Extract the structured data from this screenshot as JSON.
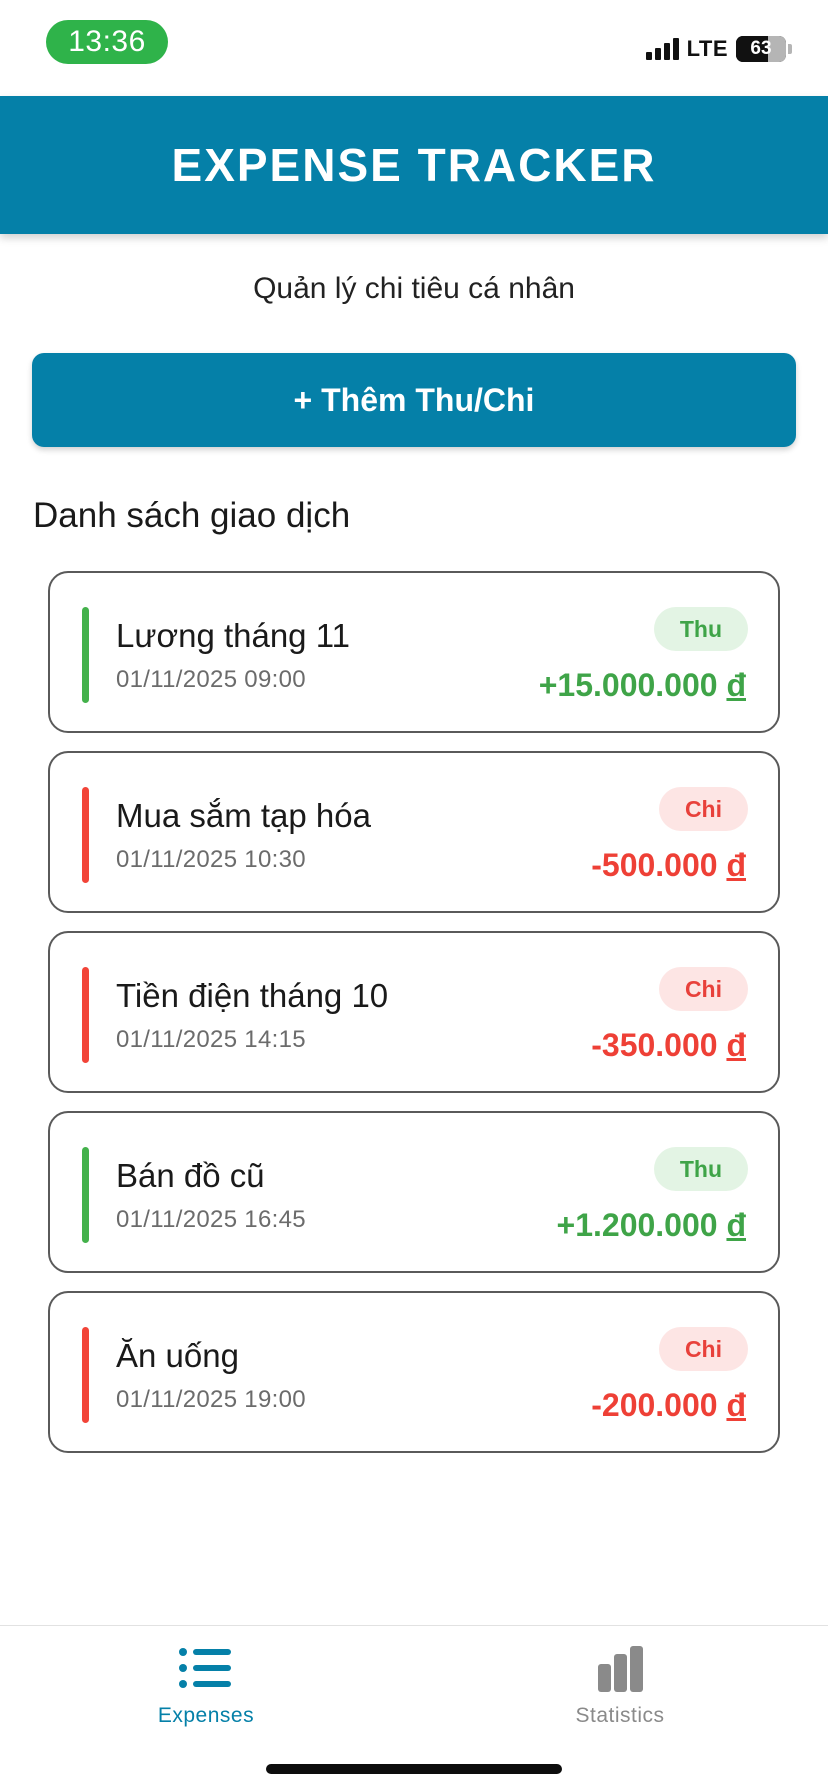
{
  "status_bar": {
    "time": "13:36",
    "network": "LTE",
    "battery": "63",
    "time_pill_color": "#2fb34a"
  },
  "header": {
    "title": "EXPENSE TRACKER",
    "color": "#0580a8"
  },
  "subtitle": "Quản lý chi tiêu cá nhân",
  "add_button": {
    "label": "+ Thêm Thu/Chi"
  },
  "section_title": "Danh sách giao dịch",
  "transactions": [
    {
      "name": "Lương tháng 11",
      "datetime": "01/11/2025 09:00",
      "type_label": "Thu",
      "kind": "income",
      "amount": "+15.000.000",
      "currency": "đ"
    },
    {
      "name": "Mua sắm tạp hóa",
      "datetime": "01/11/2025 10:30",
      "type_label": "Chi",
      "kind": "expense",
      "amount": "-500.000",
      "currency": "đ"
    },
    {
      "name": "Tiền điện tháng 10",
      "datetime": "01/11/2025 14:15",
      "type_label": "Chi",
      "kind": "expense",
      "amount": "-350.000",
      "currency": "đ"
    },
    {
      "name": "Bán đồ cũ",
      "datetime": "01/11/2025 16:45",
      "type_label": "Thu",
      "kind": "income",
      "amount": "+1.200.000",
      "currency": "đ"
    },
    {
      "name": "Ăn uống",
      "datetime": "01/11/2025 19:00",
      "type_label": "Chi",
      "kind": "expense",
      "amount": "-200.000",
      "currency": "đ"
    }
  ],
  "colors": {
    "income": "#3fa448",
    "expense": "#ee4036"
  },
  "bottom_nav": {
    "items": [
      {
        "label": "Expenses",
        "icon": "list-icon",
        "active": true
      },
      {
        "label": "Statistics",
        "icon": "bar-chart-icon",
        "active": false
      }
    ]
  }
}
